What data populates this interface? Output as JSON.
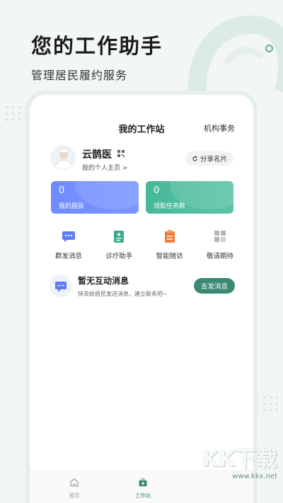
{
  "hero": {
    "headline": "您的工作助手",
    "subline": "管理居民履约服务"
  },
  "screen": {
    "title": "我的工作站",
    "org_link": "机构事务",
    "profile": {
      "name": "云鹊医",
      "homepage_label": "我的个人主页 >",
      "share_label": "分享名片"
    },
    "stats": [
      {
        "value": "0",
        "label": "我的居民",
        "color": "#6f8cff"
      },
      {
        "value": "0",
        "label": "领取任务数",
        "color": "#47b89a"
      }
    ],
    "shortcuts": [
      {
        "label": "群发消息",
        "icon": "chat-bubble-icon",
        "color": "#5b7cf5"
      },
      {
        "label": "诊疗助手",
        "icon": "clipboard-plus-icon",
        "color": "#3aa98a"
      },
      {
        "label": "智能随访",
        "icon": "clipboard-list-icon",
        "color": "#f07c3c"
      },
      {
        "label": "敬请期待",
        "icon": "grid-icon",
        "color": "#b5b5b5"
      }
    ],
    "empty_state": {
      "title": "暂无互动消息",
      "desc": "快去给居民发送消息，建立联系吧~",
      "button": "去发消息"
    },
    "tabbar": [
      {
        "label": "首页"
      },
      {
        "label": "工作站"
      }
    ]
  },
  "watermark": {
    "main": "KK下载",
    "sub": "www.kkx.net"
  }
}
